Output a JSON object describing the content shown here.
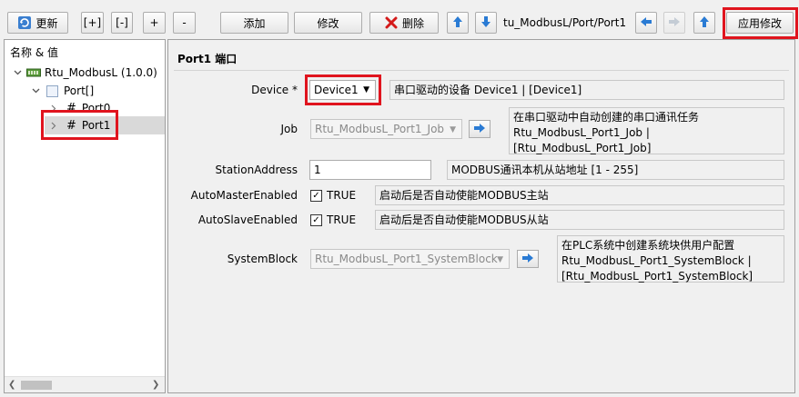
{
  "toolbar": {
    "refresh_label": "更新",
    "expand_label": "[+]",
    "collapse_label": "[-]",
    "plus_label": "+",
    "minus_label": "-",
    "add_label": "添加",
    "modify_label": "修改",
    "delete_label": "删除",
    "path": "tu_ModbusL/Port/Port1",
    "apply_label": "应用修改"
  },
  "tree": {
    "header": "名称 & 值",
    "root": "Rtu_ModbusL (1.0.0)",
    "port_array": "Port[]",
    "port0": "Port0",
    "port1": "Port1",
    "hash": "#"
  },
  "panel": {
    "title": "Port1 端口"
  },
  "props": {
    "device": {
      "label": "Device *",
      "value": "Device1",
      "desc": "串口驱动的设备 Device1 | [Device1]"
    },
    "job": {
      "label": "Job",
      "value": "Rtu_ModbusL_Port1_Job",
      "desc1": "在串口驱动中自动创建的串口通讯任务",
      "desc2": "Rtu_ModbusL_Port1_Job |",
      "desc3": "[Rtu_ModbusL_Port1_Job]"
    },
    "station": {
      "label": "StationAddress",
      "value": "1",
      "desc": "MODBUS通讯本机从站地址 [1 - 255]"
    },
    "auto_master": {
      "label": "AutoMasterEnabled",
      "value": "TRUE",
      "desc": "启动后是否自动使能MODBUS主站"
    },
    "auto_slave": {
      "label": "AutoSlaveEnabled",
      "value": "TRUE",
      "desc": "启动后是否自动使能MODBUS从站"
    },
    "system_block": {
      "label": "SystemBlock",
      "value": "Rtu_ModbusL_Port1_SystemBlock",
      "desc1": "在PLC系统中创建系统块供用户配置",
      "desc2": "Rtu_ModbusL_Port1_SystemBlock |",
      "desc3": "[Rtu_ModbusL_Port1_SystemBlock]"
    }
  },
  "colors": {
    "highlight": "#e0141e",
    "arrow_blue": "#2a7bd4",
    "delete_red": "#d41a1a"
  }
}
